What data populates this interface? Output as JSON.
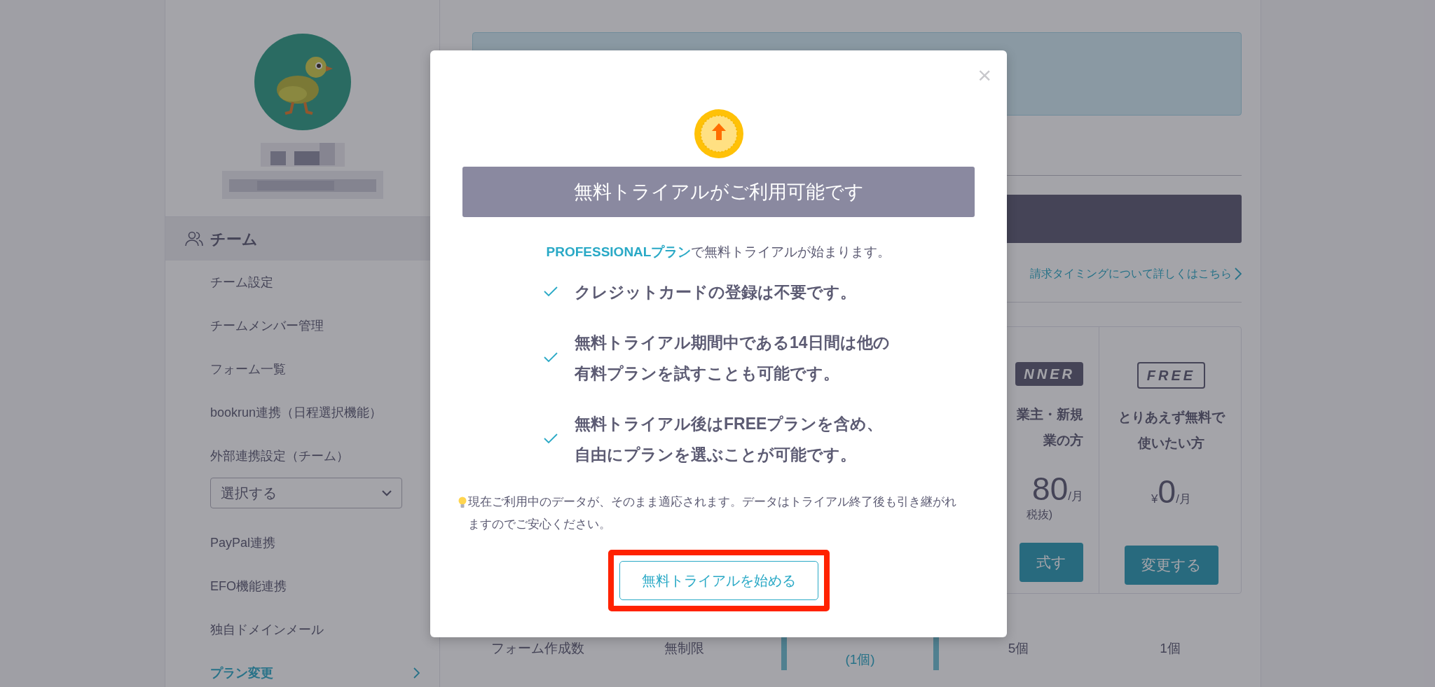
{
  "sidebar": {
    "team_header": "チーム",
    "items": [
      {
        "kind": "link",
        "label": "チーム設定",
        "selected": false
      },
      {
        "kind": "link",
        "label": "チームメンバー管理",
        "selected": false
      },
      {
        "kind": "link",
        "label": "フォーム一覧",
        "selected": false
      },
      {
        "kind": "link",
        "label": "bookrun連携（日程選択機能）",
        "selected": false
      },
      {
        "kind": "link",
        "label": "外部連携設定（チーム）",
        "selected": false
      },
      {
        "kind": "select",
        "label": "選択する",
        "selected": false
      },
      {
        "kind": "link",
        "label": "PayPal連携",
        "selected": false
      },
      {
        "kind": "link",
        "label": "EFO機能連携",
        "selected": false
      },
      {
        "kind": "link",
        "label": "独自ドメインメール",
        "selected": false
      },
      {
        "kind": "link",
        "label": "プラン変更",
        "selected": true
      }
    ]
  },
  "main": {
    "billing_link": "請求タイミングについて詳しくはこちら",
    "plans": [
      {
        "kind": "filled",
        "badge": "NNER",
        "target_lines": [
          "業主・新規",
          "業の方"
        ],
        "price": "80",
        "unit": "/月",
        "tax": "税抜)",
        "button": "式す"
      },
      {
        "kind": "outline",
        "badge": "FREE",
        "target_lines": [
          "とりあえず無料で",
          "使いたい方"
        ],
        "currency": "¥",
        "price": "0",
        "unit": "/月",
        "button": "変更する"
      }
    ],
    "table": {
      "rows": [
        {
          "cells": [
            "フォーム作成数",
            "無制限",
            "(1個)",
            "5個",
            "1個"
          ]
        }
      ]
    }
  },
  "modal": {
    "close": "×",
    "title": "無料トライアルがご利用可能です",
    "intro_highlight": "PROFESSIONALプラン",
    "intro_rest": "で無料トライアルが始まります。",
    "benefits": [
      {
        "lines": [
          "クレジットカードの登録は不要です。"
        ]
      },
      {
        "lines": [
          "無料トライアル期間中である14日間は他の",
          "有料プランを試すことも可能です。"
        ]
      },
      {
        "lines": [
          "無料トライアル後はFREEプランを含め、",
          "自由にプランを選ぶことが可能です。"
        ]
      }
    ],
    "note": "現在ご利用中のデータが、そのまま適応されます。データはトライアル終了後も引き継がれますのでご安心ください。",
    "button": "無料トライアルを始める"
  }
}
